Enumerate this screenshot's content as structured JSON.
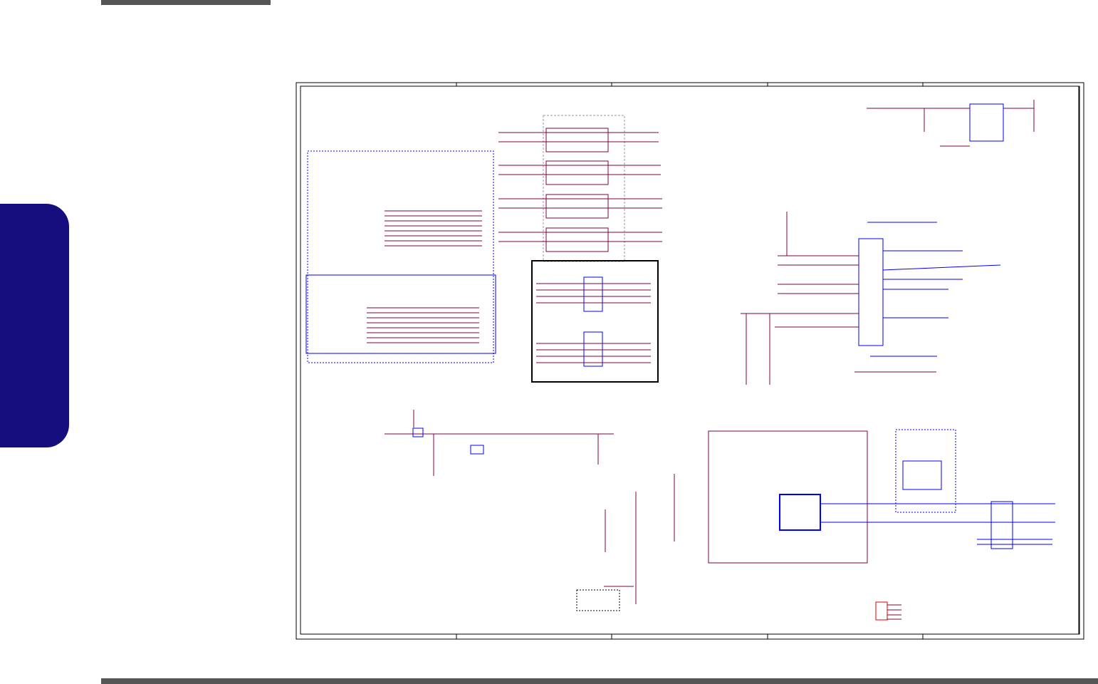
{
  "colors": {
    "side_tab": "#140e7e",
    "bars": "#555555",
    "wire": "#800040",
    "component": "#e00000",
    "blue_component": "#0000ff",
    "frame": "#000000"
  },
  "icons": [
    "schematic-diagram"
  ]
}
